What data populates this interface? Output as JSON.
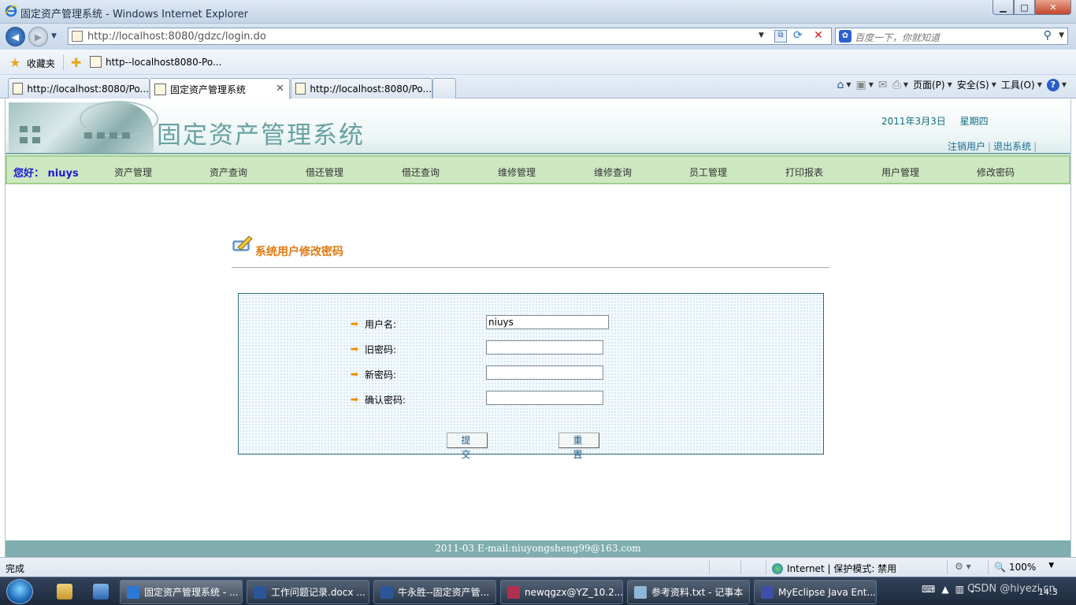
{
  "window": {
    "title": "固定资产管理系统 - Windows Internet Explorer",
    "min": "▁",
    "max": "□",
    "close": "✕"
  },
  "address": {
    "url": "http://localhost:8080/gdzc/login.do",
    "search_placeholder": "百度一下，你就知道"
  },
  "favorites": {
    "label": "收藏夹",
    "items": [
      "http--localhost8080-Po..."
    ]
  },
  "tabs": [
    {
      "label": "http://localhost:8080/Po...",
      "active": false
    },
    {
      "label": "固定资产管理系统",
      "active": true
    },
    {
      "label": "http://localhost:8080/Po...",
      "active": false
    }
  ],
  "commandbar": {
    "page": "页面(P)",
    "safety": "安全(S)",
    "tools": "工具(O)",
    "help": "?"
  },
  "header": {
    "system_name": "固定资产管理系统",
    "date": "2011年3月3日",
    "weekday": "星期四",
    "logout_user": "注销用户",
    "exit_system": "退出系统"
  },
  "menu": {
    "greeting": "您好： niuys",
    "items": [
      "资产管理",
      "资产查询",
      "借还管理",
      "借还查询",
      "维修管理",
      "维修查询",
      "员工管理",
      "打印报表",
      "用户管理",
      "修改密码"
    ]
  },
  "form": {
    "title": "系统用户修改密码",
    "fields": [
      {
        "label": "用户名:",
        "value": ""
      },
      {
        "label": "旧密码:",
        "value": ""
      },
      {
        "label": "新密码:",
        "value": ""
      },
      {
        "label": "确认密码:",
        "value": ""
      }
    ],
    "username_value": "niuys",
    "submit": "提 交",
    "reset": "重 置"
  },
  "footer": {
    "text": "2011-03 E-mail:niuyongsheng99@163.com"
  },
  "status": {
    "done": "完成",
    "zone": "Internet | 保护模式: 禁用",
    "zoom": "100%"
  },
  "taskbar": {
    "items": [
      "固定资产管理系统 - ...",
      "工作问题记录.docx ...",
      "牛永胜--固定资产管...",
      "newqgzx@YZ_10.2....",
      "参考资料.txt - 记事本",
      "MyEclipse Java Ent..."
    ],
    "clock": "14:3",
    "watermark": "CSDN @hiyezi.cn"
  },
  "colors": {
    "accent_green": "#cde8c1",
    "footer_teal": "#80adad",
    "form_title_orange": "#e0780e",
    "greeting_blue": "#1b1bd1"
  }
}
